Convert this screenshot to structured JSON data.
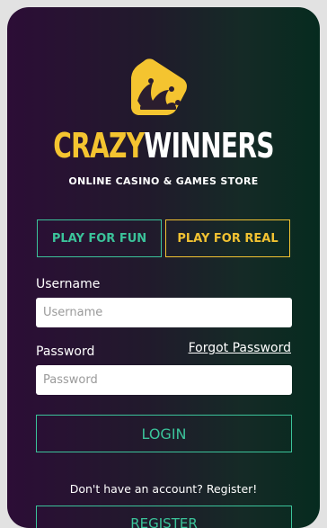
{
  "brand": {
    "name_part1": "CRAZY",
    "name_part2": "WINNERS",
    "tagline": "ONLINE CASINO & GAMES STORE"
  },
  "tabs": {
    "fun_label": "PLAY FOR FUN",
    "real_label": "PLAY FOR REAL"
  },
  "form": {
    "username_label": "Username",
    "username_placeholder": "Username",
    "password_label": "Password",
    "password_placeholder": "Password",
    "forgot_label": "Forgot Password",
    "login_label": "LOGIN"
  },
  "footer": {
    "signup_prompt": "Don't have an account? Register!",
    "register_label": "REGISTER"
  },
  "colors": {
    "accent_green": "#3bc39a",
    "accent_gold": "#f1c232",
    "logo_yellow": "#f4c430"
  },
  "icons": {
    "logo": "jester-hat-icon"
  }
}
